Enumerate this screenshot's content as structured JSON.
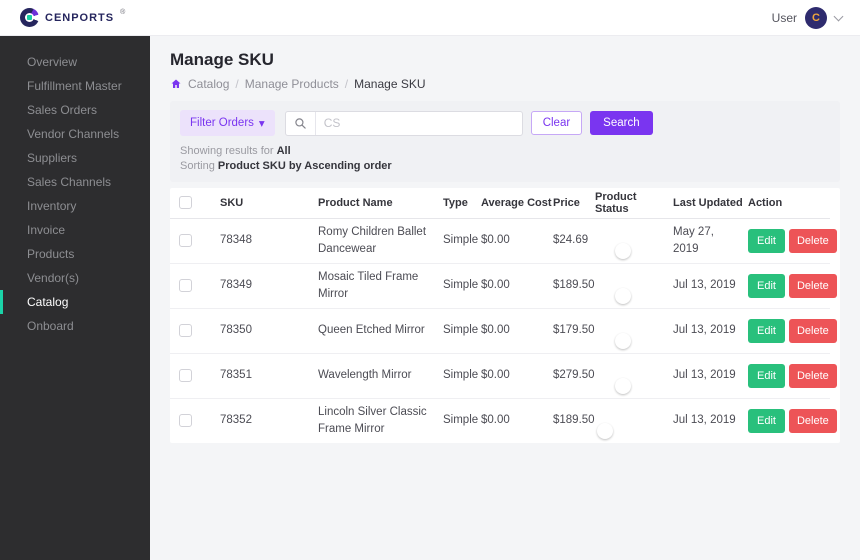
{
  "topbar": {
    "brand": "CENPORTS",
    "registered": "®",
    "user_label": "User",
    "avatar_initial": "C"
  },
  "sidebar": {
    "items": [
      {
        "label": "Overview",
        "active": false
      },
      {
        "label": "Fulfillment Master",
        "active": false
      },
      {
        "label": "Sales Orders",
        "active": false
      },
      {
        "label": "Vendor Channels",
        "active": false
      },
      {
        "label": "Suppliers",
        "active": false
      },
      {
        "label": "Sales Channels",
        "active": false
      },
      {
        "label": "Inventory",
        "active": false
      },
      {
        "label": "Invoice",
        "active": false
      },
      {
        "label": "Products",
        "active": false
      },
      {
        "label": "Vendor(s)",
        "active": false
      },
      {
        "label": "Catalog",
        "active": true
      },
      {
        "label": "Onboard",
        "active": false
      }
    ]
  },
  "page": {
    "title": "Manage SKU",
    "breadcrumb": [
      "Catalog",
      "Manage Products",
      "Manage SKU"
    ],
    "breadcrumb_separator": "/"
  },
  "filters": {
    "filter_button_label": "Filter Orders",
    "caret_glyph": "▾",
    "search_placeholder": "CS",
    "clear_label": "Clear",
    "search_label": "Search",
    "showing_prefix": "Showing results for",
    "showing_value": "All",
    "sorting_prefix": "Sorting",
    "sorting_value": "Product SKU by Ascending order"
  },
  "table": {
    "headers": [
      "SKU",
      "Product Name",
      "Type",
      "Average Cost",
      "Price",
      "Product Status",
      "Last Updated",
      "Action"
    ],
    "edit_label": "Edit",
    "delete_label": "Delete",
    "rows": [
      {
        "sku": "78348",
        "product_name": "Romy Children Ballet Dancewear",
        "type": "Simple",
        "average_cost": "$0.00",
        "price": "$24.69",
        "status_on": true,
        "last_updated": "May 27, 2019"
      },
      {
        "sku": "78349",
        "product_name": "Mosaic Tiled Frame Mirror",
        "type": "Simple",
        "average_cost": "$0.00",
        "price": "$189.50",
        "status_on": true,
        "last_updated": "Jul 13, 2019"
      },
      {
        "sku": "78350",
        "product_name": "Queen Etched Mirror",
        "type": "Simple",
        "average_cost": "$0.00",
        "price": "$179.50",
        "status_on": true,
        "last_updated": "Jul 13, 2019"
      },
      {
        "sku": "78351",
        "product_name": "Wavelength Mirror",
        "type": "Simple",
        "average_cost": "$0.00",
        "price": "$279.50",
        "status_on": true,
        "last_updated": "Jul 13, 2019"
      },
      {
        "sku": "78352",
        "product_name": "Lincoln Silver Classic Frame Mirror",
        "type": "Simple",
        "average_cost": "$0.00",
        "price": "$189.50",
        "status_on": false,
        "last_updated": "Jul 13, 2019"
      }
    ]
  },
  "colors": {
    "accent_purple": "#7a35f0",
    "accent_purple_light": "#ece2fb",
    "toggle_green": "#15c672",
    "edit_green": "#29c07c",
    "delete_red": "#ed5457",
    "thumb_amber": "#f0b32e",
    "sidebar_active_teal": "#1bd3a8",
    "avatar_navy": "#2e2b6e",
    "avatar_gold": "#f0a63c",
    "logo_navy": "#26265e",
    "logo_purple": "#6d30d8",
    "logo_teal": "#19cfa4"
  }
}
